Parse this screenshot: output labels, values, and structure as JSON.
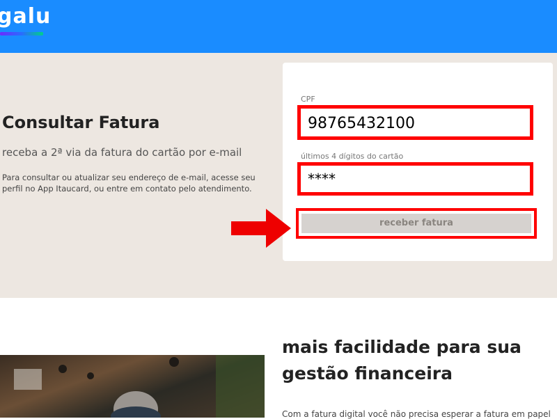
{
  "header": {
    "logo_text": "galu"
  },
  "hero": {
    "title": "Consultar Fatura",
    "subtitle": "receba a 2ª via da fatura do cartão por e-mail",
    "description": "Para consultar ou atualizar seu endereço de e-mail, acesse seu perfil no App Itaucard, ou entre em contato pelo atendimento."
  },
  "form": {
    "cpf_label": "CPF",
    "cpf_value": "98765432100",
    "digits_label": "últimos 4 dígitos do cartão",
    "digits_value": "****",
    "submit_label": "receber fatura"
  },
  "section": {
    "title": "mais facilidade para sua gestão financeira",
    "text": "Com a fatura digital você não precisa esperar a fatura em papel"
  },
  "colors": {
    "header_bg": "#1a8cff",
    "hero_bg": "#ede7e1",
    "highlight": "#ff0000"
  },
  "icons": {
    "annotation_arrow": "right-arrow-icon"
  }
}
